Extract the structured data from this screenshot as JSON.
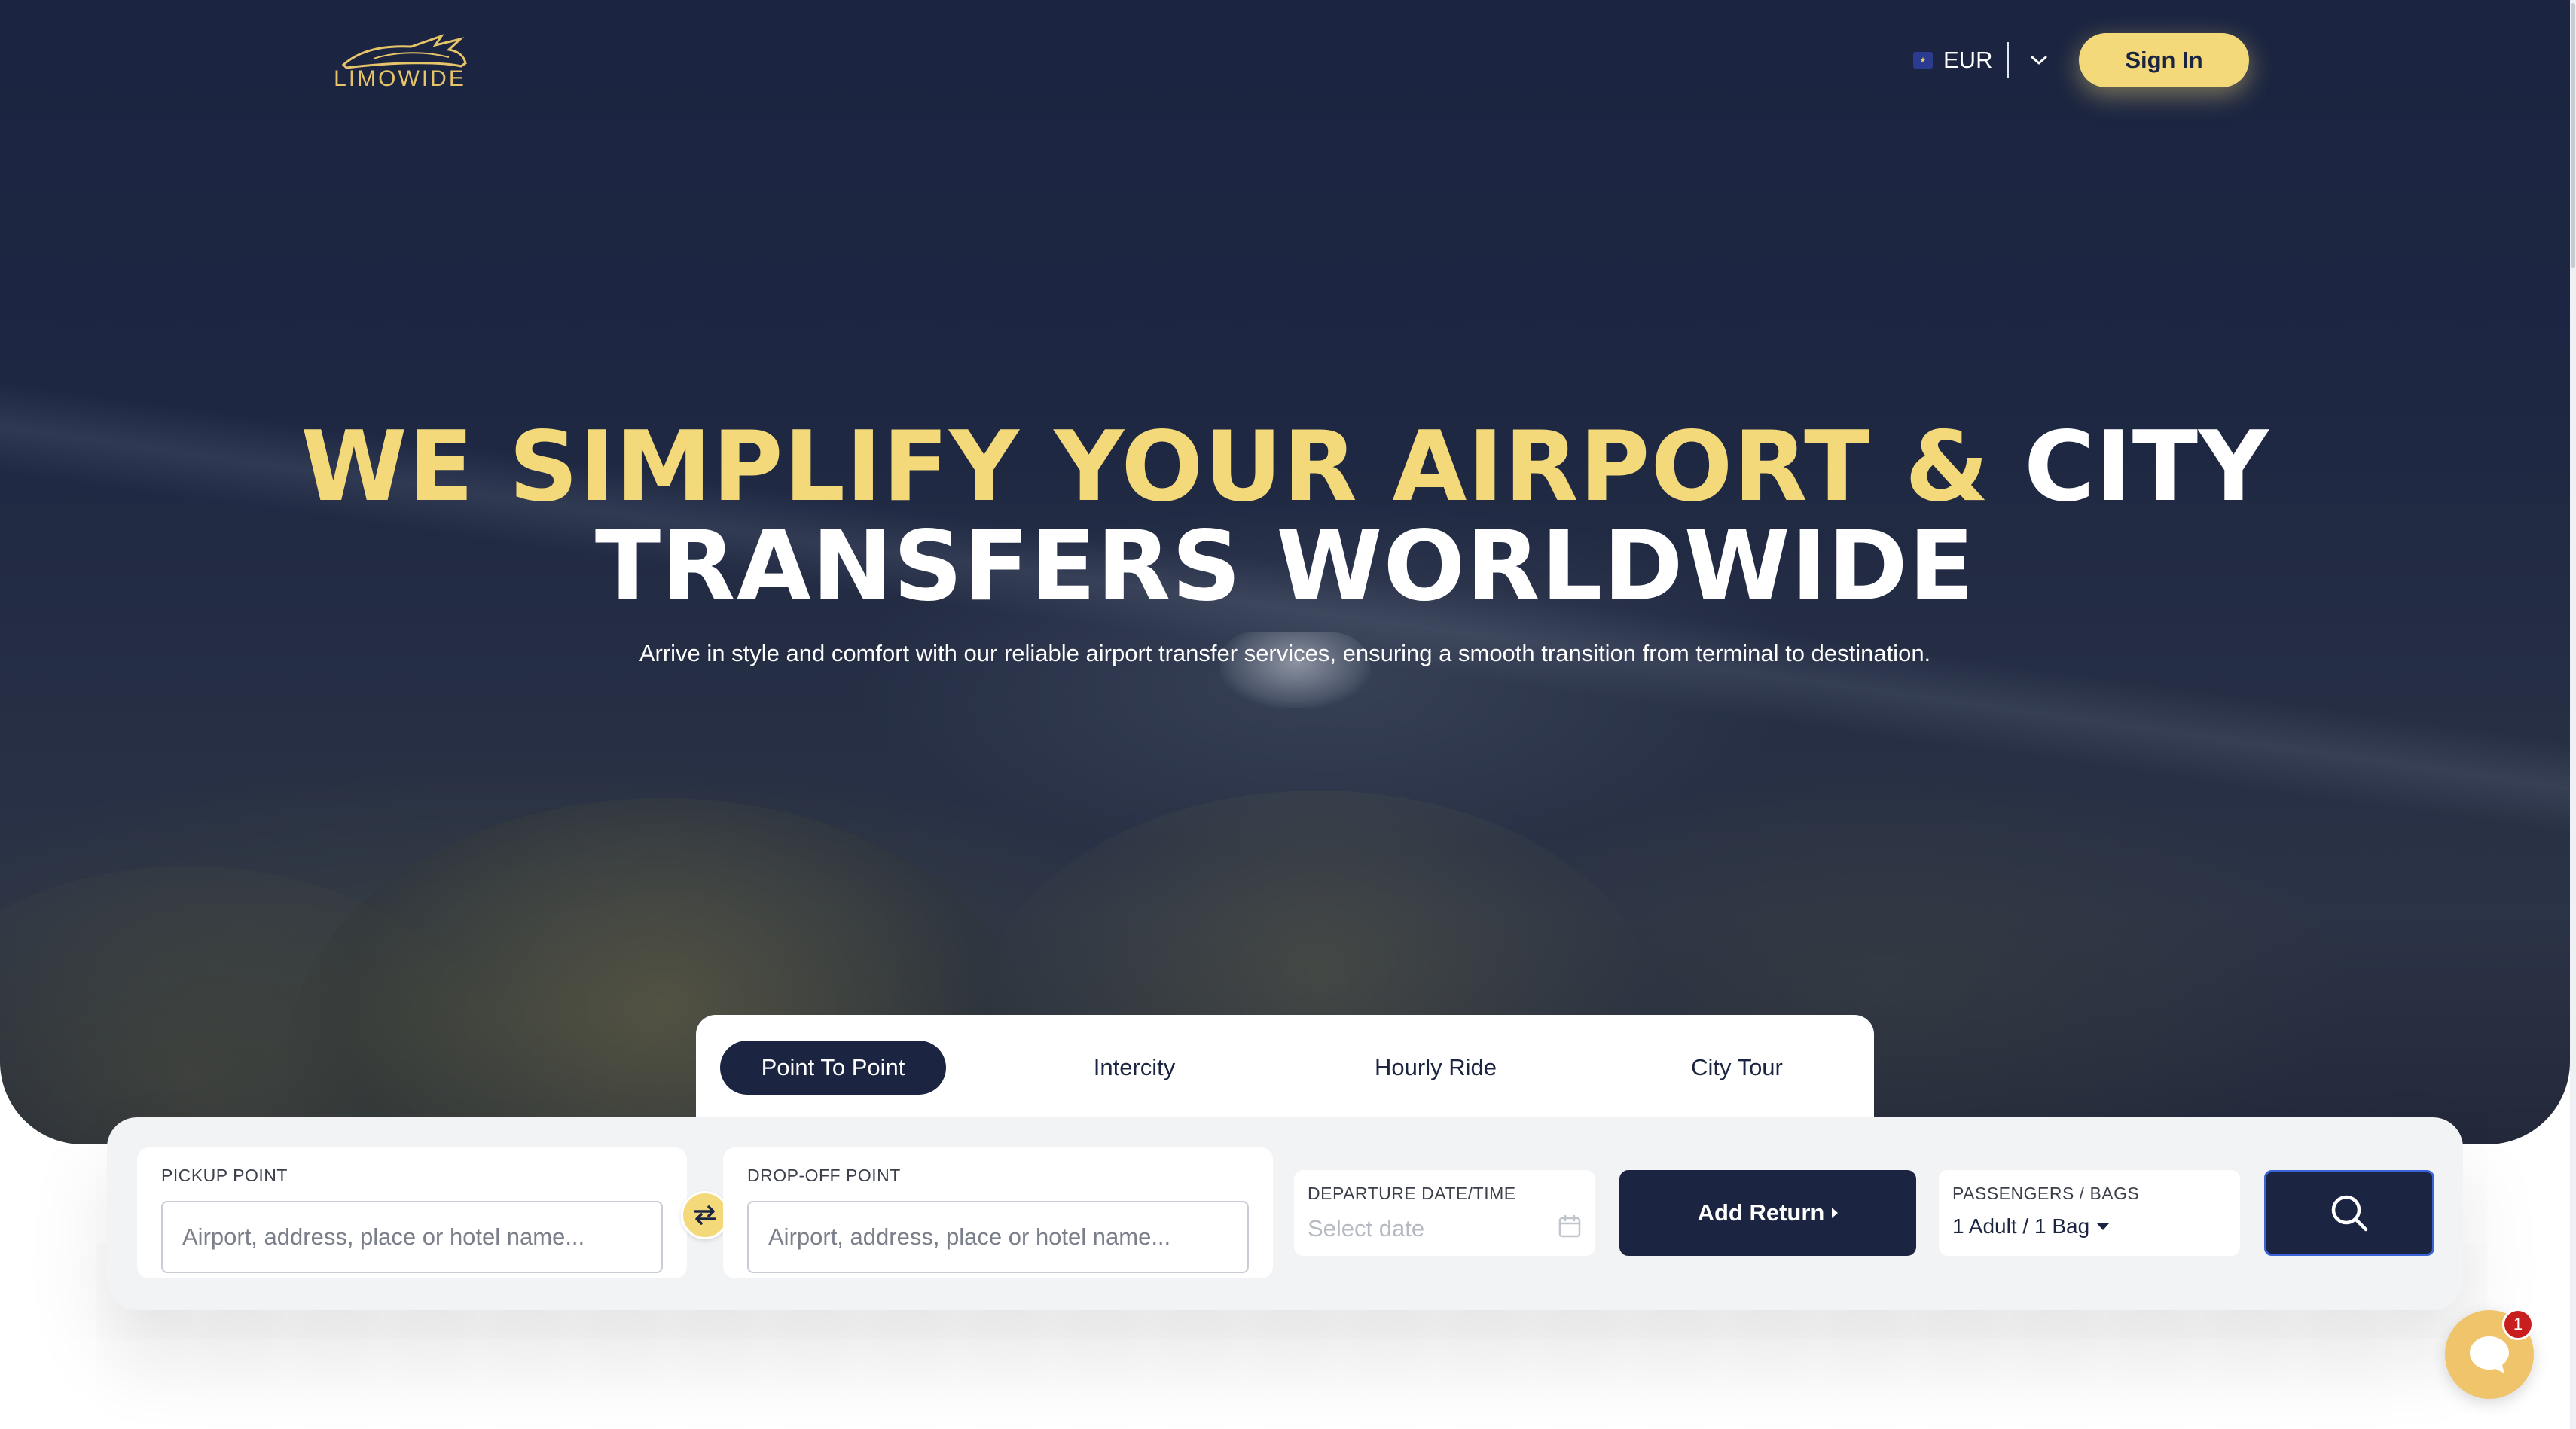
{
  "brand": {
    "logo_text": "LIMOWIDE",
    "logo_color": "#e6c46a"
  },
  "header": {
    "currency": {
      "flag_icon": "eu-flag-icon",
      "code": "EUR",
      "dropdown_icon": "chevron-down-icon"
    },
    "sign_in_label": "Sign In"
  },
  "hero": {
    "headline_line1_accent": "WE SIMPLIFY YOUR AIRPORT &",
    "headline_line1_plain": "CITY",
    "headline_line2": "TRANSFERS WORLDWIDE",
    "subtitle": "Arrive in style and comfort with our reliable airport transfer services, ensuring a smooth transition from terminal to destination."
  },
  "booking": {
    "tabs": [
      {
        "label": "Point To Point",
        "active": true
      },
      {
        "label": "Intercity",
        "active": false
      },
      {
        "label": "Hourly Ride",
        "active": false
      },
      {
        "label": "City Tour",
        "active": false
      }
    ],
    "pickup": {
      "label": "PICKUP POINT",
      "placeholder": "Airport, address, place or hotel name..."
    },
    "dropoff": {
      "label": "DROP-OFF POINT",
      "placeholder": "Airport, address, place or hotel name..."
    },
    "swap_icon": "swap-arrows-icon",
    "departure": {
      "label": "DEPARTURE DATE/TIME",
      "placeholder": "Select date",
      "icon": "calendar-icon"
    },
    "add_return_label": "Add Return",
    "passengers": {
      "label": "PASSENGERS / BAGS",
      "value": "1 Adult / 1 Bag"
    },
    "search_icon": "search-icon"
  },
  "chat": {
    "icon": "chat-bubble-icon",
    "unread_count": "1"
  },
  "colors": {
    "navy": "#1b2440",
    "accent_yellow": "#f4d97a",
    "chat_gold": "#f0c46a",
    "badge_red": "#c81e1e"
  }
}
